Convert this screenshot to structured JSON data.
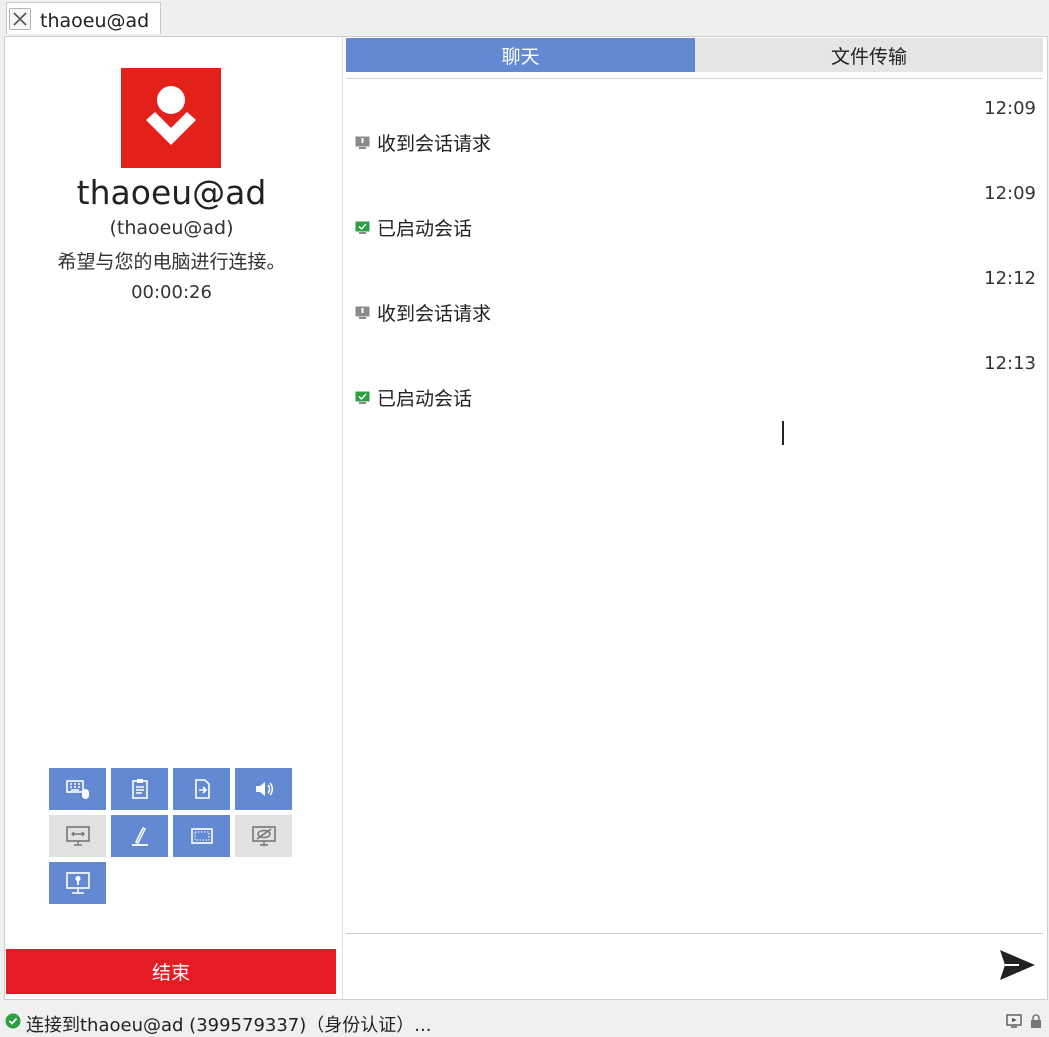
{
  "tab": {
    "title": "thaoeu@ad"
  },
  "peer": {
    "name": "thaoeu@ad",
    "id_line": "(thaoeu@ad)",
    "message": "希望与您的电脑进行连接。",
    "timer": "00:00:26"
  },
  "tools": [
    {
      "icon": "keyboard-mouse-icon",
      "enabled": true
    },
    {
      "icon": "clipboard-icon",
      "enabled": true
    },
    {
      "icon": "file-transfer-icon",
      "enabled": true
    },
    {
      "icon": "sound-icon",
      "enabled": true
    },
    {
      "icon": "switch-sides-icon",
      "enabled": false
    },
    {
      "icon": "draw-icon",
      "enabled": true
    },
    {
      "icon": "screen-record-icon",
      "enabled": true
    },
    {
      "icon": "privacy-mode-icon",
      "enabled": false
    },
    {
      "icon": "lock-screen-icon",
      "enabled": true
    }
  ],
  "end_button": {
    "label": "结束"
  },
  "right_tabs": {
    "chat": "聊天",
    "file_transfer": "文件传输"
  },
  "messages": [
    {
      "time": "12:09",
      "text": "收到会话请求",
      "icon": "session-request-icon"
    },
    {
      "time": "12:09",
      "text": "已启动会话",
      "icon": "session-started-icon"
    },
    {
      "time": "12:12",
      "text": "收到会话请求",
      "icon": "session-request-icon"
    },
    {
      "time": "12:13",
      "text": "已启动会话",
      "icon": "session-started-icon"
    }
  ],
  "status": {
    "text": "连接到thaoeu@ad (399579337)（身份认证）..."
  },
  "colors": {
    "accent": "#6389d3",
    "end": "#e51c23",
    "logo": "#e3201a",
    "ok": "#2ea043"
  }
}
